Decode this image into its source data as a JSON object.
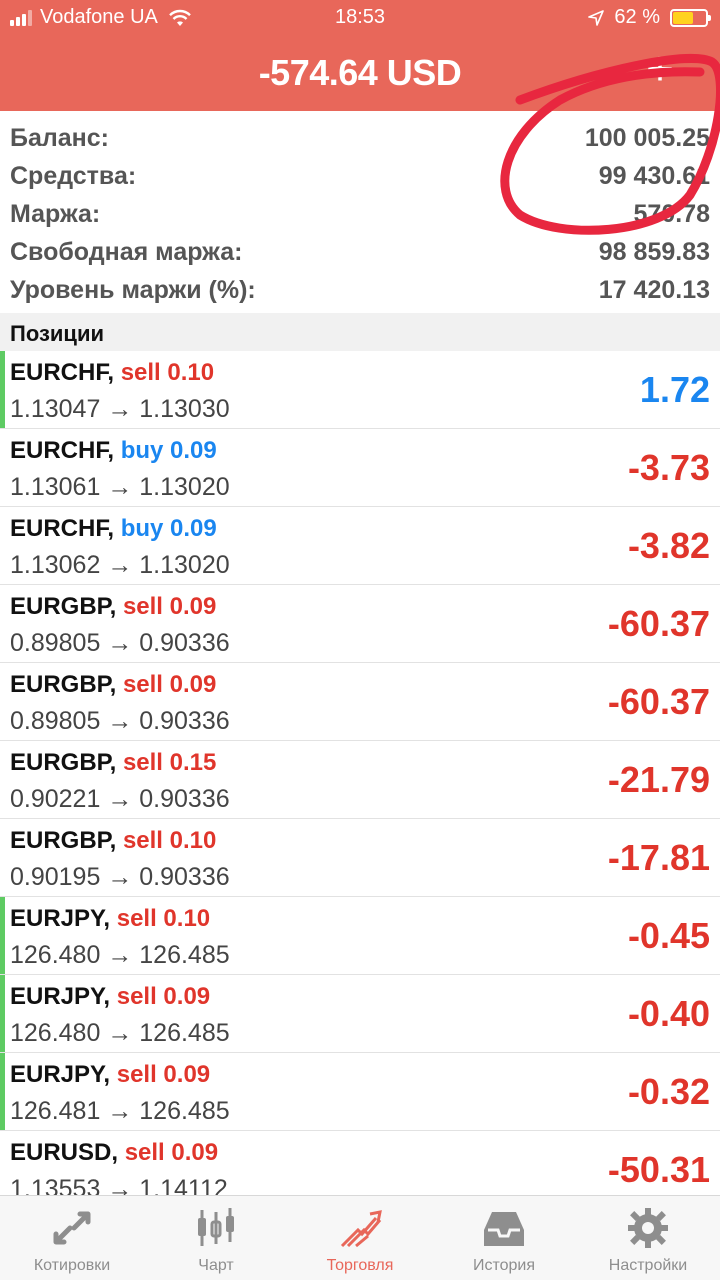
{
  "status": {
    "carrier": "Vodafone UA",
    "time": "18:53",
    "battery": "62 %",
    "battery_level": 0.62
  },
  "header": {
    "title": "-574.64 USD",
    "add_label": "+"
  },
  "summary": [
    {
      "label": "Баланс:",
      "value": "100 005.25"
    },
    {
      "label": "Средства:",
      "value": "99 430.61"
    },
    {
      "label": "Маржа:",
      "value": "570.78"
    },
    {
      "label": "Свободная маржа:",
      "value": "98 859.83"
    },
    {
      "label": "Уровень маржи (%):",
      "value": "17 420.13"
    }
  ],
  "section_title": "Позиции",
  "positions": [
    {
      "symbol": "EURCHF,",
      "dir": "sell",
      "volume": "0.10",
      "prices": "1.13047 → 1.13030",
      "profit": "1.72"
    },
    {
      "symbol": "EURCHF,",
      "dir": "buy",
      "volume": "0.09",
      "prices": "1.13061 → 1.13020",
      "profit": "-3.73"
    },
    {
      "symbol": "EURCHF,",
      "dir": "buy",
      "volume": "0.09",
      "prices": "1.13062 → 1.13020",
      "profit": "-3.82"
    },
    {
      "symbol": "EURGBP,",
      "dir": "sell",
      "volume": "0.09",
      "prices": "0.89805 → 0.90336",
      "profit": "-60.37"
    },
    {
      "symbol": "EURGBP,",
      "dir": "sell",
      "volume": "0.09",
      "prices": "0.89805 → 0.90336",
      "profit": "-60.37"
    },
    {
      "symbol": "EURGBP,",
      "dir": "sell",
      "volume": "0.15",
      "prices": "0.90221 → 0.90336",
      "profit": "-21.79"
    },
    {
      "symbol": "EURGBP,",
      "dir": "sell",
      "volume": "0.10",
      "prices": "0.90195 → 0.90336",
      "profit": "-17.81"
    },
    {
      "symbol": "EURJPY,",
      "dir": "sell",
      "volume": "0.10",
      "prices": "126.480 → 126.485",
      "profit": "-0.45"
    },
    {
      "symbol": "EURJPY,",
      "dir": "sell",
      "volume": "0.09",
      "prices": "126.480 → 126.485",
      "profit": "-0.40"
    },
    {
      "symbol": "EURJPY,",
      "dir": "sell",
      "volume": "0.09",
      "prices": "126.481 → 126.485",
      "profit": "-0.32"
    },
    {
      "symbol": "EURUSD,",
      "dir": "sell",
      "volume": "0.09",
      "prices": "1.13553 → 1.14112",
      "profit": "-50.31"
    }
  ],
  "tabs": [
    {
      "label": "Котировки",
      "icon": "quotes-icon"
    },
    {
      "label": "Чарт",
      "icon": "chart-icon"
    },
    {
      "label": "Торговля",
      "icon": "trade-icon",
      "active": true
    },
    {
      "label": "История",
      "icon": "history-icon"
    },
    {
      "label": "Настройки",
      "icon": "settings-icon"
    }
  ],
  "colors": {
    "header": "#e8675a",
    "sell": "#e0352b",
    "buy": "#1a86f0",
    "profit_bar": "#5ecb63",
    "annotation": "#e8273f"
  }
}
